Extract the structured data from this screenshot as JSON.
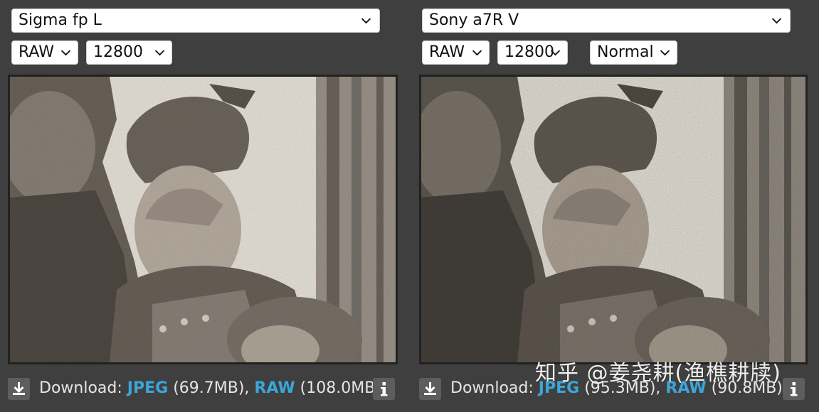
{
  "left": {
    "camera": "Sigma fp L",
    "format": "RAW",
    "iso": "12800",
    "download": {
      "label": "Download:",
      "jpeg_label": "JPEG",
      "jpeg_size": "(69.7MB),",
      "raw_label": "RAW",
      "raw_size": "(108.0MB)"
    }
  },
  "right": {
    "camera": "Sony a7R V",
    "format": "RAW",
    "iso": "12800",
    "mode": "Normal",
    "download": {
      "label": "Download:",
      "jpeg_label": "JPEG",
      "jpeg_size": "(95.3MB),",
      "raw_label": "RAW",
      "raw_size": "(90.8MB)"
    }
  },
  "watermark": "知乎 @姜尧耕(渔樵耕牍)",
  "icons": {
    "download": "download-icon",
    "info": "info-icon",
    "chevron": "chevron-down-icon"
  },
  "colors": {
    "background": "#3f3f3f",
    "link": "#3ba7d9",
    "button": "#5d5d5d"
  }
}
